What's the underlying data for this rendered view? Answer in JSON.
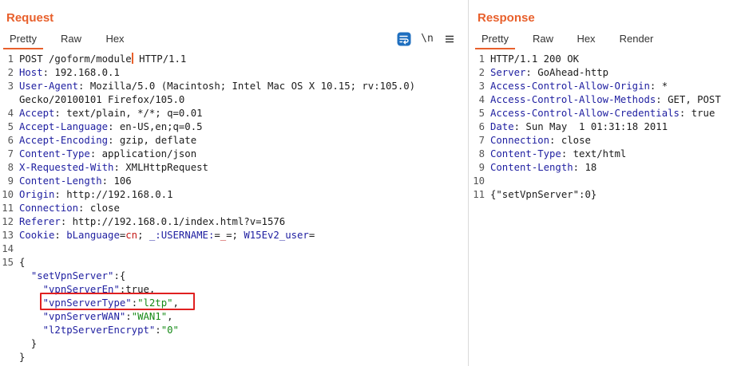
{
  "request": {
    "title": "Request",
    "tabs": [
      "Pretty",
      "Raw",
      "Hex"
    ],
    "active_tab": "Pretty",
    "toolbar": {
      "wrap_icon": "wrap-lines-icon",
      "newline_label": "\\n",
      "menu_icon": "hamburger-menu-icon"
    },
    "lines": [
      {
        "n": "1",
        "parts": [
          [
            "POST /goform/module",
            "plain"
          ],
          [
            "",
            "cursor"
          ],
          [
            " HTTP/1.1",
            "plain"
          ]
        ]
      },
      {
        "n": "2",
        "parts": [
          [
            "Host",
            "hn"
          ],
          [
            ": 192.168.0.1",
            "plain"
          ]
        ]
      },
      {
        "n": "3",
        "parts": [
          [
            "User-Agent",
            "hn"
          ],
          [
            ": Mozilla/5.0 (Macintosh; Intel Mac OS X 10.15; rv:105.0)",
            "plain"
          ]
        ]
      },
      {
        "n": "",
        "parts": [
          [
            "Gecko/20100101 Firefox/105.0",
            "plain"
          ]
        ]
      },
      {
        "n": "4",
        "parts": [
          [
            "Accept",
            "hn"
          ],
          [
            ": text/plain, */*; q=0.01",
            "plain"
          ]
        ]
      },
      {
        "n": "5",
        "parts": [
          [
            "Accept-Language",
            "hn"
          ],
          [
            ": en-US,en;q=0.5",
            "plain"
          ]
        ]
      },
      {
        "n": "6",
        "parts": [
          [
            "Accept-Encoding",
            "hn"
          ],
          [
            ": gzip, deflate",
            "plain"
          ]
        ]
      },
      {
        "n": "7",
        "parts": [
          [
            "Content-Type",
            "hn"
          ],
          [
            ": application/json",
            "plain"
          ]
        ]
      },
      {
        "n": "8",
        "parts": [
          [
            "X-Requested-With",
            "hn"
          ],
          [
            ": XMLHttpRequest",
            "plain"
          ]
        ]
      },
      {
        "n": "9",
        "parts": [
          [
            "Content-Length",
            "hn"
          ],
          [
            ": 106",
            "plain"
          ]
        ]
      },
      {
        "n": "10",
        "parts": [
          [
            "Origin",
            "hn"
          ],
          [
            ": http://192.168.0.1",
            "plain"
          ]
        ]
      },
      {
        "n": "11",
        "parts": [
          [
            "Connection",
            "hn"
          ],
          [
            ": close",
            "plain"
          ]
        ]
      },
      {
        "n": "12",
        "parts": [
          [
            "Referer",
            "hn"
          ],
          [
            ": http://192.168.0.1/index.html?v=1576",
            "plain"
          ]
        ]
      },
      {
        "n": "13",
        "parts": [
          [
            "Cookie",
            "hn"
          ],
          [
            ": ",
            "plain"
          ],
          [
            "bLanguage",
            "blue"
          ],
          [
            "=",
            "plain"
          ],
          [
            "cn",
            "red"
          ],
          [
            "; ",
            "plain"
          ],
          [
            "_:USERNAME:",
            "blue"
          ],
          [
            "=",
            "plain"
          ],
          [
            "_",
            "red"
          ],
          [
            "=; ",
            "plain"
          ],
          [
            "W15Ev2_user",
            "blue"
          ],
          [
            "=",
            "plain"
          ]
        ]
      },
      {
        "n": "14",
        "parts": []
      },
      {
        "n": "15",
        "parts": [
          [
            "{",
            "plain"
          ]
        ]
      },
      {
        "n": "",
        "parts": [
          [
            "  ",
            "plain"
          ],
          [
            "\"setVpnServer\"",
            "blue"
          ],
          [
            ":{",
            "plain"
          ]
        ]
      },
      {
        "n": "",
        "parts": [
          [
            "    ",
            "plain"
          ],
          [
            "\"vpnServerEn\"",
            "blue"
          ],
          [
            ":true,",
            "plain"
          ]
        ]
      },
      {
        "n": "",
        "parts": [
          [
            "    ",
            "plain"
          ],
          [
            "\"vpnServerType\"",
            "blue"
          ],
          [
            ":",
            "plain"
          ],
          [
            "\"l2tp\"",
            "green"
          ],
          [
            ",",
            "plain"
          ]
        ]
      },
      {
        "n": "",
        "parts": [
          [
            "    ",
            "plain"
          ],
          [
            "\"vpnServerWAN\"",
            "blue"
          ],
          [
            ":",
            "plain"
          ],
          [
            "\"WAN1\"",
            "green"
          ],
          [
            ",",
            "plain"
          ]
        ]
      },
      {
        "n": "",
        "parts": [
          [
            "    ",
            "plain"
          ],
          [
            "\"l2tpServerEncrypt\"",
            "blue"
          ],
          [
            ":",
            "plain"
          ],
          [
            "\"0\"",
            "green"
          ]
        ]
      },
      {
        "n": "",
        "parts": [
          [
            "  }",
            "plain"
          ]
        ]
      },
      {
        "n": "",
        "parts": [
          [
            "}",
            "plain"
          ]
        ]
      }
    ]
  },
  "response": {
    "title": "Response",
    "tabs": [
      "Pretty",
      "Raw",
      "Hex",
      "Render"
    ],
    "active_tab": "Pretty",
    "lines": [
      {
        "n": "1",
        "parts": [
          [
            "HTTP/1.1 200 OK",
            "plain"
          ]
        ]
      },
      {
        "n": "2",
        "parts": [
          [
            "Server",
            "hn"
          ],
          [
            ": GoAhead-http",
            "plain"
          ]
        ]
      },
      {
        "n": "3",
        "parts": [
          [
            "Access-Control-Allow-Origin",
            "hn"
          ],
          [
            ": *",
            "plain"
          ]
        ]
      },
      {
        "n": "4",
        "parts": [
          [
            "Access-Control-Allow-Methods",
            "hn"
          ],
          [
            ": GET, POST",
            "plain"
          ]
        ]
      },
      {
        "n": "5",
        "parts": [
          [
            "Access-Control-Allow-Credentials",
            "hn"
          ],
          [
            ": true",
            "plain"
          ]
        ]
      },
      {
        "n": "6",
        "parts": [
          [
            "Date",
            "hn"
          ],
          [
            ": Sun May  1 01:31:18 2011",
            "plain"
          ]
        ]
      },
      {
        "n": "7",
        "parts": [
          [
            "Connection",
            "hn"
          ],
          [
            ": close",
            "plain"
          ]
        ]
      },
      {
        "n": "8",
        "parts": [
          [
            "Content-Type",
            "hn"
          ],
          [
            ": text/html",
            "plain"
          ]
        ]
      },
      {
        "n": "9",
        "parts": [
          [
            "Content-Length",
            "hn"
          ],
          [
            ": 18",
            "plain"
          ]
        ]
      },
      {
        "n": "10",
        "parts": []
      },
      {
        "n": "11",
        "parts": [
          [
            "{\"setVpnServer\":0}",
            "plain"
          ]
        ]
      }
    ]
  },
  "colors": {
    "accent": "#e8602c",
    "header_name": "#1e1ea0",
    "string": "#168a17",
    "value_red": "#c41a16",
    "highlight": "#e02020"
  }
}
